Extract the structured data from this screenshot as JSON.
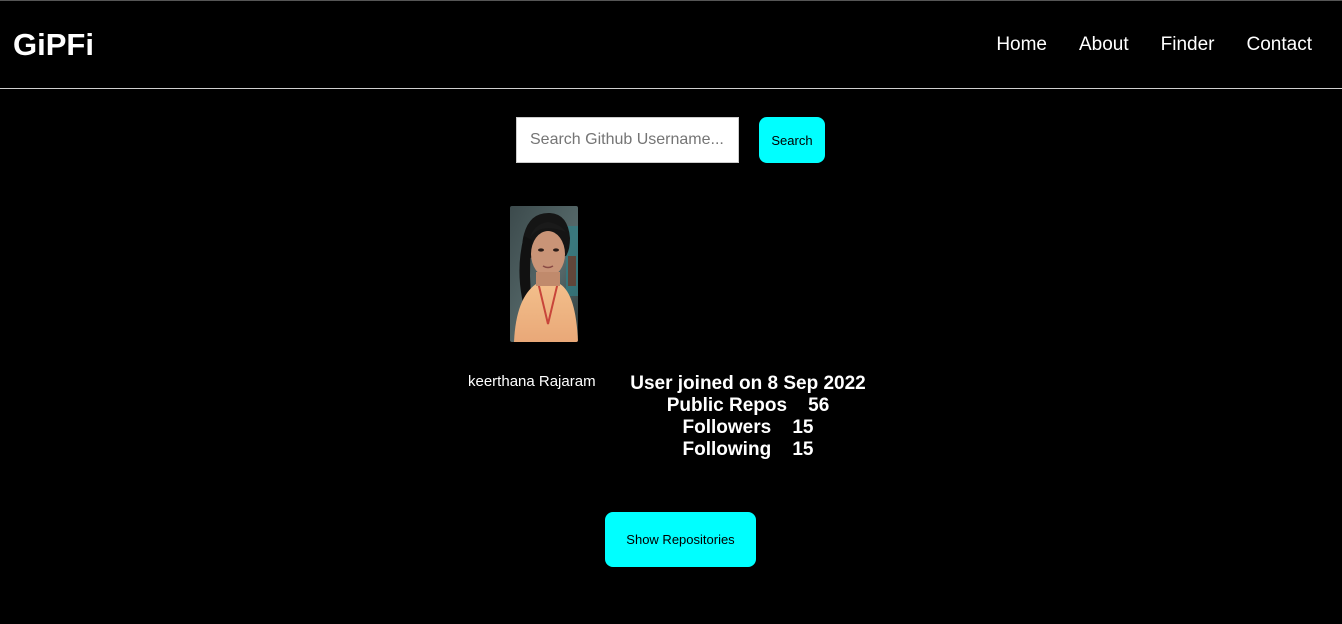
{
  "header": {
    "brand": "GiPFi",
    "nav": [
      {
        "label": "Home"
      },
      {
        "label": "About"
      },
      {
        "label": "Finder"
      },
      {
        "label": "Contact"
      }
    ]
  },
  "search": {
    "placeholder": "Search Github Username...",
    "value": "",
    "button_label": "Search"
  },
  "profile": {
    "name": "keerthana Rajaram",
    "joined": "User joined on 8 Sep 2022",
    "public_repos_label": "Public Repos",
    "public_repos": "56",
    "followers_label": "Followers",
    "followers": "15",
    "following_label": "Following",
    "following": "15"
  },
  "actions": {
    "show_repos_label": "Show Repositories"
  },
  "colors": {
    "background": "#000000",
    "accent": "#00ffff",
    "text": "#ffffff"
  }
}
